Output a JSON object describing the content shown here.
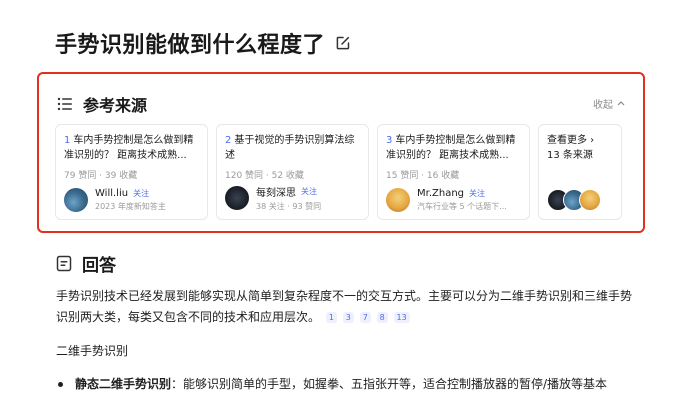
{
  "question": {
    "title": "手势识别能做到什么程度了"
  },
  "references": {
    "title": "参考来源",
    "collapse_label": "收起",
    "cards": [
      {
        "index": "1",
        "title": "车内手势控制是怎么做到精准识别的？ 距离技术成熟...",
        "stats": "79 赞同 · 39 收藏",
        "author": "Will.liu",
        "follow": "关注",
        "desc": "2023 年度新知答主"
      },
      {
        "index": "2",
        "title": "基于视觉的手势识别算法综述",
        "stats": "120 赞同 · 52 收藏",
        "author": "每刻深思",
        "follow": "关注",
        "desc": "38 关注 · 93 赞同"
      },
      {
        "index": "3",
        "title": "车内手势控制是怎么做到精准识别的？ 距离技术成熟...",
        "stats": "15 赞同 · 16 收藏",
        "author": "Mr.Zhang",
        "follow": "关注",
        "desc": "汽车行业等 5 个话题下..."
      }
    ],
    "more": {
      "line1": "查看更多 ›",
      "line2": "13 条来源"
    }
  },
  "answer": {
    "title": "回答",
    "intro": "手势识别技术已经发展到能够实现从简单到复杂程度不一的交互方式。主要可以分为二维手势识别和三维手势识别两大类，每类又包含不同的技术和应用层次。",
    "citations": [
      "1",
      "3",
      "7",
      "8",
      "13"
    ],
    "section_title": "二维手势识别",
    "bullet_bold": "静态二维手势识别",
    "bullet_text": "：能够识别简单的手型，如握拳、五指张开等，适合控制播放器的暂停/播放等基本"
  }
}
